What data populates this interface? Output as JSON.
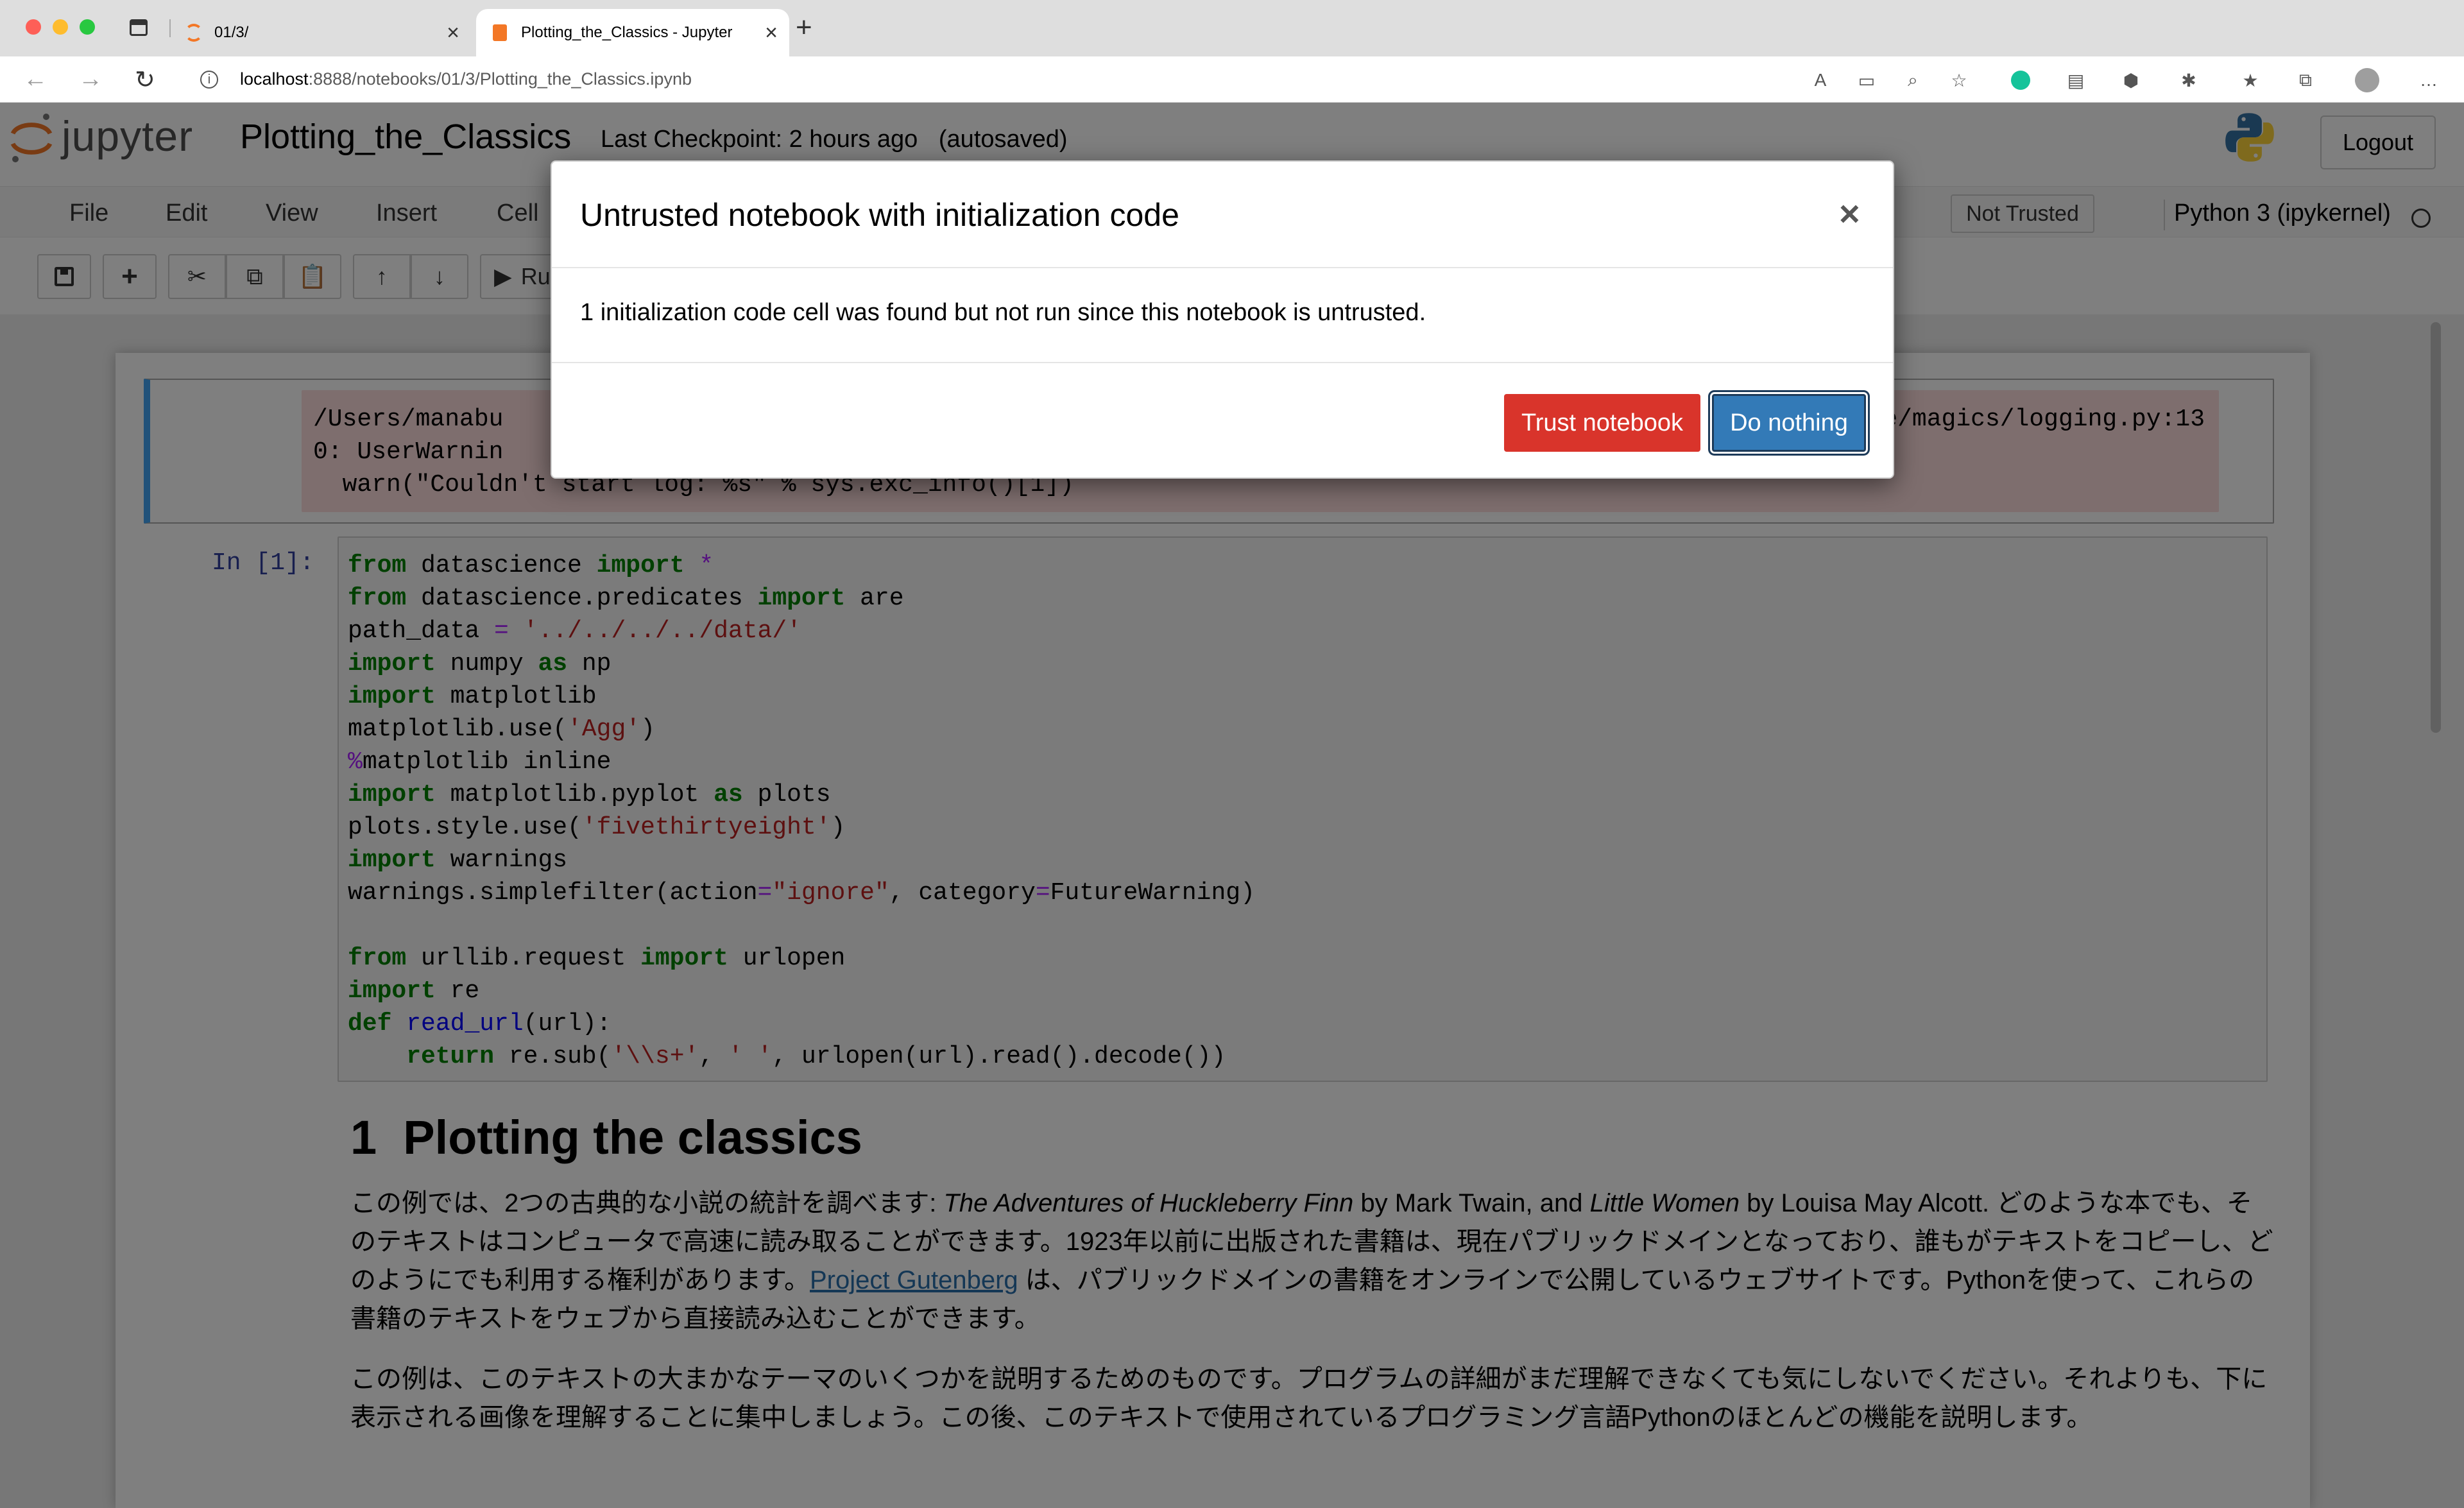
{
  "browser": {
    "tabs": [
      {
        "label": "01/3/"
      },
      {
        "label": "Plotting_the_Classics - Jupyter"
      }
    ],
    "new_tab_label": "+",
    "url_host": "localhost",
    "url_rest": ":8888/notebooks/01/3/Plotting_the_Classics.ipynb"
  },
  "jupyter": {
    "logo_text": "jupyter",
    "notebook_name": "Plotting_the_Classics",
    "checkpoint": "Last Checkpoint: 2 hours ago",
    "autosave": "(autosaved)",
    "logout_label": "Logout",
    "menu": [
      "File",
      "Edit",
      "View",
      "Insert",
      "Cell"
    ],
    "trust_status": "Not Trusted",
    "kernel_name": "Python 3 (ipykernel)",
    "run_label": "Ru"
  },
  "cells": {
    "error_output": [
      "/Users/manabu",
      "0: UserWarnin",
      "  warn(\"Couldn't start log: %s\" % sys.exc_info()[1])"
    ],
    "error_output_tail": "e/magics/logging.py:13",
    "prompt": "In [1]:"
  },
  "markdown": {
    "heading_number": "1",
    "heading_text": "Plotting the classics",
    "p1_a": "この例では、2つの古典的な小説の統計を調べます: ",
    "p1_b": "The Adventures of Huckleberry Finn",
    "p1_c": " by Mark Twain, and ",
    "p1_d": "Little Women",
    "p1_e": " by Louisa May Alcott. どのような本でも、そのテキストはコンピュータで高速に読み取ることができます。1923年以前に出版された書籍は、現在パブリックドメインとなっており、誰もがテキストをコピーし、どのようにでも利用する権利があります。",
    "p1_link": "Project Gutenberg",
    "p1_f": " は、パブリックドメインの書籍をオンラインで公開しているウェブサイトです。Pythonを使って、これらの書籍のテキストをウェブから直接読み込むことができます。",
    "p2": "この例は、このテキストの大まかなテーマのいくつかを説明するためのものです。プログラムの詳細がまだ理解できなくても気にしないでください。それよりも、下に表示される画像を理解することに集中しましょう。この後、このテキストで使用されているプログラミング言語Pythonのほとんどの機能を説明します。"
  },
  "modal": {
    "title": "Untrusted notebook with initialization code",
    "close_label": "×",
    "body": "1 initialization code cell was found but not run since this notebook is untrusted.",
    "trust_button": "Trust notebook",
    "nothing_button": "Do nothing"
  },
  "colors": {
    "trust_button": "#d9342b",
    "nothing_button": "#337ab7",
    "error_bg": "#fddddd",
    "prompt": "#303f9f",
    "keyword": "#008000",
    "string": "#ba2121"
  }
}
